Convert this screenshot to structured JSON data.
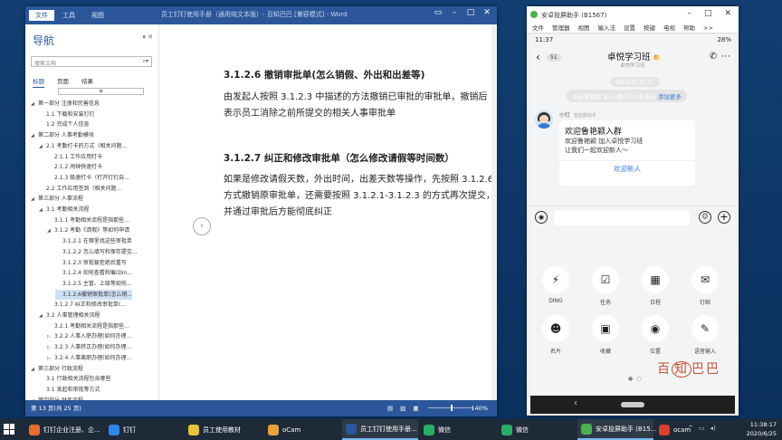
{
  "word": {
    "menu": [
      "文件",
      "工具",
      "视图"
    ],
    "doc_title": "员工钉钉使用手册（通用纯文本版）- 百知巴巴 [兼容模式] - Word",
    "nav_title": "导航",
    "search_placeholder": "搜索文档",
    "tabs": [
      "标题",
      "页面",
      "结果"
    ],
    "collapse": "≡",
    "tree": [
      {
        "label": "第一部分 注册和完善信息",
        "indent": 0,
        "arrow": "◢"
      },
      {
        "label": "1.1 下载和安装钉钉",
        "indent": 1,
        "arrow": ""
      },
      {
        "label": "1.2 完成个人信息",
        "indent": 1,
        "arrow": ""
      },
      {
        "label": "第二部分 人事考勤模块",
        "indent": 0,
        "arrow": "◢"
      },
      {
        "label": "2.1 考勤打卡的方式（相关问题...",
        "indent": 1,
        "arrow": "◢"
      },
      {
        "label": "2.1.1 工作应用打卡",
        "indent": 2,
        "arrow": ""
      },
      {
        "label": "2.1.2 闹钟快速打卡",
        "indent": 2,
        "arrow": ""
      },
      {
        "label": "2.1.3 极速打卡（打开钉钉自...",
        "indent": 2,
        "arrow": ""
      },
      {
        "label": "2.2 工作应用签到（相关问题...",
        "indent": 1,
        "arrow": ""
      },
      {
        "label": "第三部分 人事流程",
        "indent": 0,
        "arrow": "◢"
      },
      {
        "label": "3.1 考勤相关流程",
        "indent": 1,
        "arrow": "◢"
      },
      {
        "label": "3.1.1 考勤相关流程是指那些...",
        "indent": 2,
        "arrow": ""
      },
      {
        "label": "3.1.2 考勤《请假》等如何申请",
        "indent": 2,
        "arrow": "◢"
      },
      {
        "label": "3.1.2.1 在哪里找这些审批单",
        "indent": 3,
        "arrow": ""
      },
      {
        "label": "3.1.2.2 怎么填写和保存提交...",
        "indent": 3,
        "arrow": ""
      },
      {
        "label": "3.1.2.3 审批被拒绝后重写",
        "indent": 3,
        "arrow": ""
      },
      {
        "label": "3.1.2.4 如何查看和催(Din...",
        "indent": 3,
        "arrow": ""
      },
      {
        "label": "3.1.2.5 主管、上级等如何...",
        "indent": 3,
        "arrow": ""
      },
      {
        "label": "3.1.2.6撤销审批单(怎么销...",
        "indent": 3,
        "arrow": "",
        "selected": true
      },
      {
        "label": "3.1.2.7 纠正和修改审批单(...",
        "indent": 2,
        "arrow": ""
      },
      {
        "label": "3.2 人事管理相关流程",
        "indent": 1,
        "arrow": "◢"
      },
      {
        "label": "3.2.1 考勤相关流程是指那些...",
        "indent": 2,
        "arrow": ""
      },
      {
        "label": "3.2.2 人事入职办理(如何办理...",
        "indent": 2,
        "arrow": "▷"
      },
      {
        "label": "3.2.3 人事转正办理(如何办理...",
        "indent": 2,
        "arrow": "▷"
      },
      {
        "label": "3.2.4 人事离职办理(如何办理...",
        "indent": 2,
        "arrow": "▷"
      },
      {
        "label": "第三部分 行政流程",
        "indent": 0,
        "arrow": "◢"
      },
      {
        "label": "3.1 行政相关流程包含哪些",
        "indent": 1,
        "arrow": ""
      },
      {
        "label": "3.1 发起和审批等方式",
        "indent": 1,
        "arrow": ""
      },
      {
        "label": "第四部分 财务流程",
        "indent": 0,
        "arrow": "◢"
      },
      {
        "label": "4.1 财务相关流程包含哪些",
        "indent": 1,
        "arrow": ""
      }
    ],
    "h1": "3.1.2.6 撤销审批单(怎么销假、外出和出差等)",
    "p1": "由发起人按照 3.1.2.3 中描述的方法撤销已审批的审批单，撤销后表示员工消除之前所提交的相关人事审批单",
    "h2": "3.1.2.7 纠正和修改审批单（怎么修改请假等时间数）",
    "p2": "如果是修改请假天数，外出时间，出差天数等操作，先按照 3.1.2.6 方式撤销原审批单，还需要按照 3.1.2.1-3.1.2.3 的方式再次提交，并通过审批后方能彻底纠正",
    "status_page": "第 13 页(共 25 页)",
    "zoom": "140%"
  },
  "emulator": {
    "title": "安卓投屏助手 (B1567)",
    "menu": [
      "文件",
      "管理器",
      "视图",
      "输入法",
      "设置",
      "按键",
      "电视",
      "帮助",
      ">>"
    ],
    "phone": {
      "time": "11:37",
      "battery": "28%",
      "back_count": "51",
      "chat_name": "卓悦学习班",
      "chat_tag": "群",
      "chat_sub": "卓悦学习班",
      "timestamp": "4月16日 20:22",
      "system_msg": "欢迎鲁艳颖 加入 群内共3名成员",
      "system_link": "添加更多",
      "sender": "小钉",
      "sender_role": "智能群助手",
      "card_title": "欢迎鲁艳颖入群",
      "card_line1": "欢迎鲁艳颖 加入卓悦学习班",
      "card_line2": "让我们一起欢迎新人～",
      "card_button": "欢迎新人",
      "tools": [
        {
          "label": "DING",
          "icon": "ding-icon",
          "glyph": "⚡"
        },
        {
          "label": "任务",
          "icon": "task-icon",
          "glyph": "☑"
        },
        {
          "label": "日程",
          "icon": "calendar-icon",
          "glyph": "▦"
        },
        {
          "label": "钉邮",
          "icon": "mail-icon",
          "glyph": "✉"
        },
        {
          "label": "名片",
          "icon": "contact-card-icon",
          "glyph": "☻"
        },
        {
          "label": "收藏",
          "icon": "favorites-icon",
          "glyph": "▣"
        },
        {
          "label": "位置",
          "icon": "location-icon",
          "glyph": "◉"
        },
        {
          "label": "语音输入",
          "icon": "voice-input-icon",
          "glyph": "✎"
        }
      ],
      "watermark": [
        "百",
        "知",
        "巴巴"
      ]
    }
  },
  "taskbar": {
    "items": [
      {
        "label": "钉钉企业注册、企...",
        "color": "#e86d2b"
      },
      {
        "label": "钉钉",
        "color": "#2f87e8"
      },
      {
        "label": "员工使用教材",
        "color": "#e8c13d"
      },
      {
        "label": "oCam",
        "color": "#e8a13d"
      },
      {
        "label": "员工钉钉使用手册...",
        "color": "#2b579a"
      },
      {
        "label": "微信",
        "color": "#2aae67"
      },
      {
        "label": "微信",
        "color": "#2aae67"
      },
      {
        "label": "安卓投屏助手 (B15...",
        "color": "#4caf50"
      },
      {
        "label": "ocam",
        "color": "#d9412f"
      }
    ],
    "clock_time": "11:38:17",
    "clock_date": "2020/6/25"
  }
}
